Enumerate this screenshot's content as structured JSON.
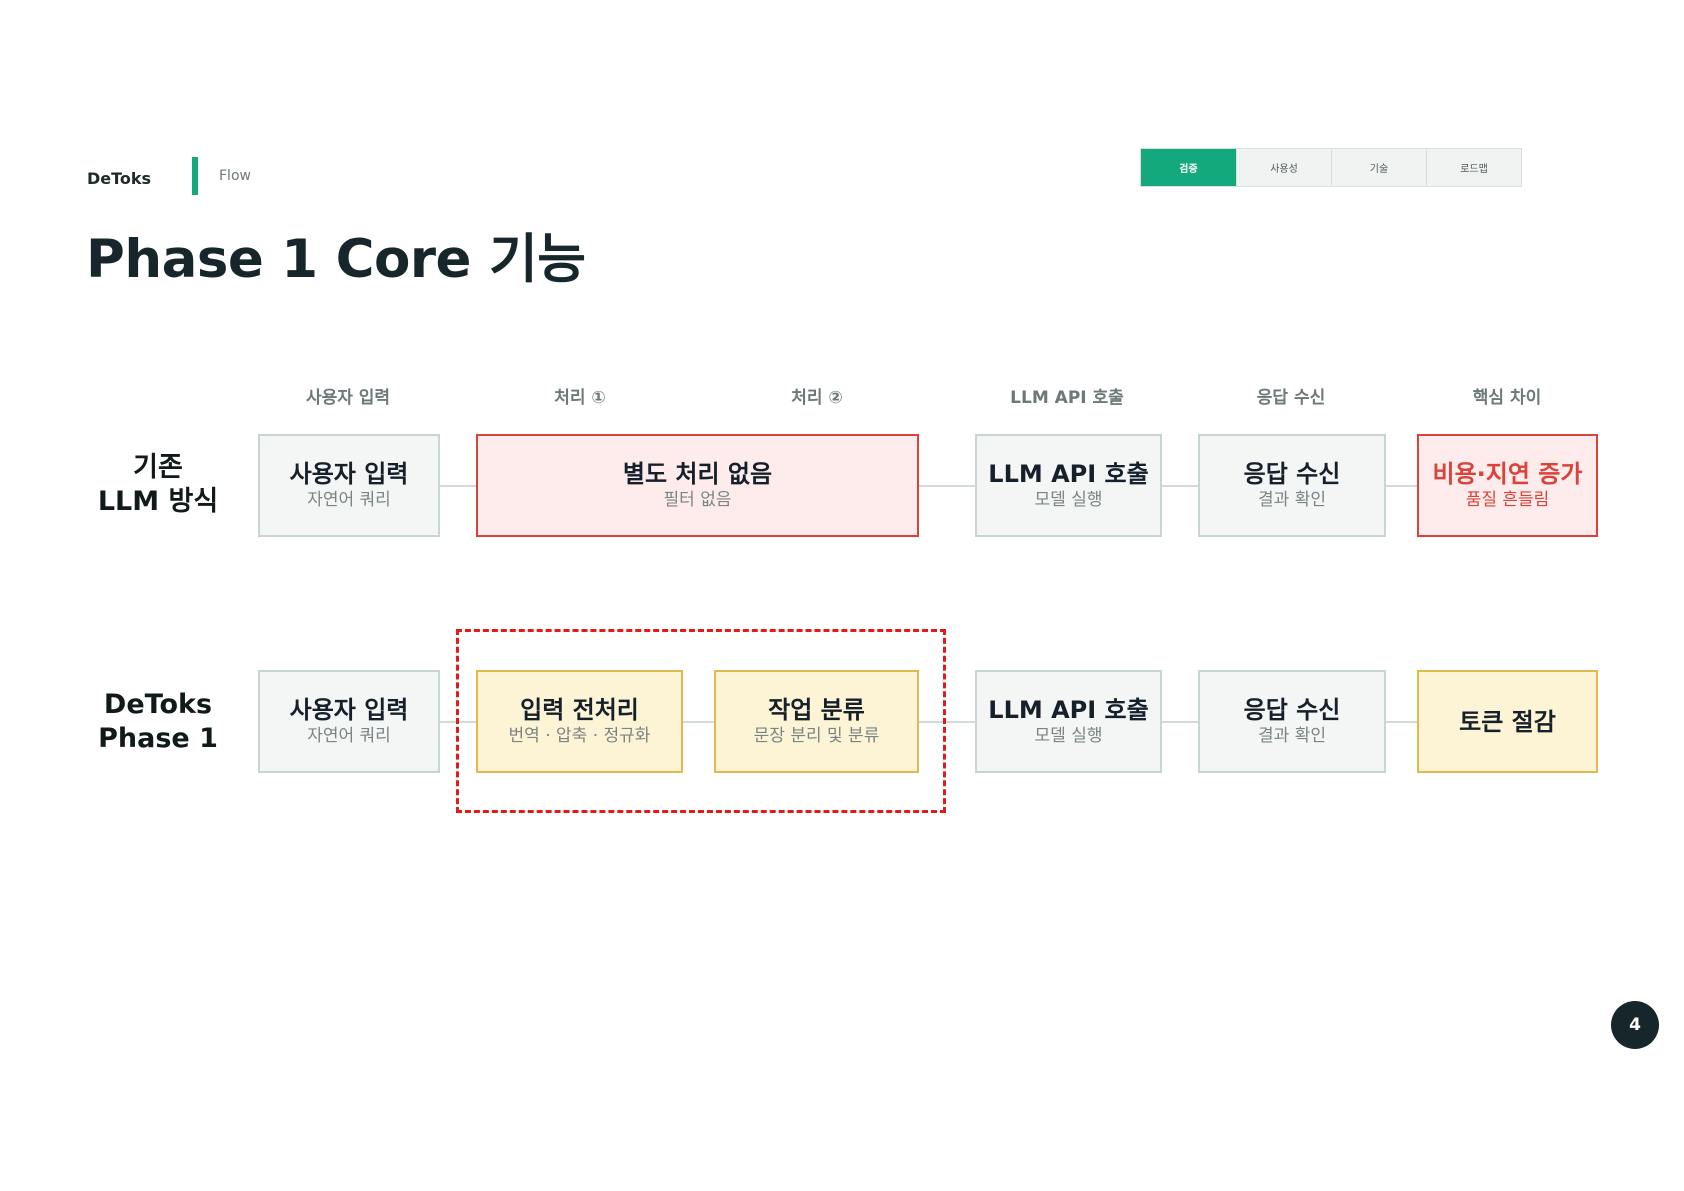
{
  "header": {
    "brand": "DeToks",
    "section": "Flow",
    "tabs": [
      {
        "label": "검증",
        "active": true
      },
      {
        "label": "사용성",
        "active": false
      },
      {
        "label": "기술",
        "active": false
      },
      {
        "label": "로드맵",
        "active": false
      }
    ]
  },
  "title": "Phase 1 Core 기능",
  "columns": [
    "사용자 입력",
    "처리 ①",
    "처리 ②",
    "LLM API 호출",
    "응답 수신",
    "핵심 차이"
  ],
  "rows": {
    "legacy": {
      "label_line1": "기존",
      "label_line2": "LLM 방식",
      "nodes": [
        {
          "title": "사용자 입력",
          "sub": "자연어 쿼리",
          "style": "gray"
        },
        {
          "title": "별도 처리 없음",
          "sub": "필터 없음",
          "style": "red"
        },
        {
          "title": "LLM API 호출",
          "sub": "모델 실행",
          "style": "gray"
        },
        {
          "title": "응답 수신",
          "sub": "결과 확인",
          "style": "gray"
        },
        {
          "title": "비용·지연 증가",
          "sub": "품질 흔들림",
          "style": "red-emphasis"
        }
      ]
    },
    "detoks": {
      "label_line1": "DeToks",
      "label_line2": "Phase 1",
      "nodes": [
        {
          "title": "사용자 입력",
          "sub": "자연어 쿼리",
          "style": "gray"
        },
        {
          "title": "입력 전처리",
          "sub": "번역 · 압축 · 정규화",
          "style": "yellow"
        },
        {
          "title": "작업 분류",
          "sub": "문장 분리 및 분류",
          "style": "yellow"
        },
        {
          "title": "LLM API 호출",
          "sub": "모델 실행",
          "style": "gray"
        },
        {
          "title": "응답 수신",
          "sub": "결과 확인",
          "style": "gray"
        },
        {
          "title": "토큰 절감",
          "sub": "",
          "style": "yellow"
        }
      ]
    }
  },
  "page_number": "4",
  "colors": {
    "accent": "#13a97d",
    "red": "#d9433b",
    "highlight_dash": "#e31a1a",
    "yellow_fill": "#fdf4d6",
    "yellow_border": "#e3b84c"
  }
}
